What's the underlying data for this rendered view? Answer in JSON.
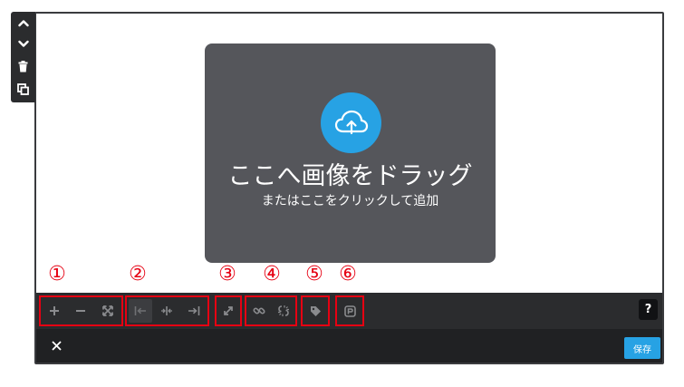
{
  "side_tools": {
    "move_up_icon": "chevron-up-icon",
    "move_down_icon": "chevron-down-icon",
    "delete_icon": "trash-icon",
    "duplicate_icon": "copy-icon"
  },
  "dropzone": {
    "title": "ここへ画像をドラッグ",
    "subtitle": "またはここをクリックして追加",
    "icon": "cloud-upload-icon"
  },
  "callouts": [
    "①",
    "②",
    "③",
    "④",
    "⑤",
    "⑥"
  ],
  "toolbar": {
    "groups": [
      {
        "name": "zoom",
        "buttons": [
          "zoom-in-icon",
          "zoom-out-icon",
          "fit-icon"
        ]
      },
      {
        "name": "align",
        "buttons": [
          "align-left-icon",
          "align-center-icon",
          "align-right-icon"
        ]
      },
      {
        "name": "fullsize",
        "buttons": [
          "expand-icon"
        ]
      },
      {
        "name": "link",
        "buttons": [
          "link-icon",
          "unlink-icon"
        ]
      },
      {
        "name": "tag",
        "buttons": [
          "tag-icon"
        ]
      },
      {
        "name": "caption",
        "buttons": [
          "caption-icon"
        ]
      }
    ],
    "help_label": "?"
  },
  "footer": {
    "close_icon": "close-icon",
    "save_label": "保存"
  },
  "colors": {
    "accent": "#27a2e4",
    "annotation": "#e60012",
    "toolbar_bg": "#2b2c2e",
    "dropzone_bg": "#55565b"
  }
}
